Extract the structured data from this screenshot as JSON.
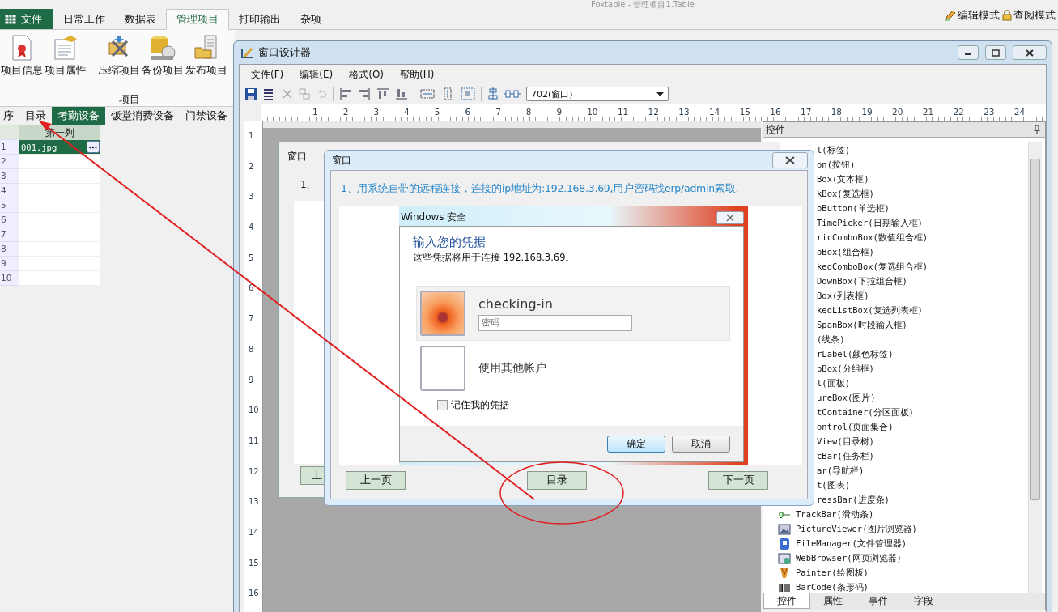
{
  "app_title": "Foxtable - 管理项目1.Table",
  "ribbon_tabs": [
    {
      "label": "文件",
      "kind": "file",
      "selected": false
    },
    {
      "label": "日常工作",
      "kind": "tab",
      "selected": false
    },
    {
      "label": "数据表",
      "kind": "tab",
      "selected": false
    },
    {
      "label": "管理项目",
      "kind": "tab",
      "selected": true
    },
    {
      "label": "打印输出",
      "kind": "tab",
      "selected": false
    },
    {
      "label": "杂项",
      "kind": "tab",
      "selected": false
    }
  ],
  "mode_buttons": [
    {
      "label": "编辑模式",
      "kind": "edit"
    },
    {
      "label": "查阅模式",
      "kind": "read"
    }
  ],
  "ribbon_buttons": [
    {
      "label": "项目信息",
      "kind": "info"
    },
    {
      "label": "项目属性",
      "kind": "props"
    },
    {
      "label": "压缩项目",
      "kind": "compress"
    },
    {
      "label": "备份项目",
      "kind": "backup"
    },
    {
      "label": "发布项目",
      "kind": "publish"
    }
  ],
  "ribbon_group": "项目",
  "sheet_tabs": [
    {
      "label": "序",
      "selected": false
    },
    {
      "label": "目录",
      "selected": false
    },
    {
      "label": "考勤设备",
      "selected": true
    },
    {
      "label": "饭堂消费设备",
      "selected": false
    },
    {
      "label": "门禁设备",
      "selected": false
    }
  ],
  "grid": {
    "column": "第一列",
    "rows": [
      {
        "number": "1",
        "value": "001.jpg",
        "selected": true
      },
      {
        "number": "2",
        "selected": false
      },
      {
        "number": "3",
        "selected": false
      },
      {
        "number": "4",
        "selected": false
      },
      {
        "number": "5",
        "selected": false
      },
      {
        "number": "6",
        "selected": false
      },
      {
        "number": "7",
        "selected": false
      },
      {
        "number": "8",
        "selected": false
      },
      {
        "number": "9",
        "selected": false
      },
      {
        "number": "10",
        "selected": false
      }
    ]
  },
  "designer": {
    "title": "窗口设计器",
    "menu": [
      "文件(F)",
      "编辑(E)",
      "格式(O)",
      "帮助(H)"
    ],
    "form_selector": "702(窗口)",
    "ruler_h": [
      "1",
      "2",
      "3",
      "4",
      "5",
      "6",
      "7",
      "8",
      "9",
      "10",
      "11",
      "12",
      "13",
      "14",
      "15",
      "16",
      "17",
      "18",
      "19",
      "20",
      "21",
      "22",
      "23",
      "24"
    ],
    "ruler_v": [
      "1",
      "2",
      "3",
      "4",
      "5",
      "6",
      "7",
      "8",
      "9",
      "10",
      "11",
      "12",
      "13",
      "14",
      "15",
      "16"
    ],
    "controls_panel": {
      "title": "控件",
      "items": [
        {
          "label": "l(标签)",
          "kind": "partial"
        },
        {
          "label": "on(按钮)",
          "kind": "partial"
        },
        {
          "label": "Box(文本框)",
          "kind": "partial"
        },
        {
          "label": "kBox(复选框)",
          "kind": "partial"
        },
        {
          "label": "oButton(单选框)",
          "kind": "partial"
        },
        {
          "label": "TimePicker(日期输入框)",
          "kind": "partial"
        },
        {
          "label": "ricComboBox(数值组合框)",
          "kind": "partial"
        },
        {
          "label": "oBox(组合框)",
          "kind": "partial"
        },
        {
          "label": "kedComboBox(复选组合框)",
          "kind": "partial"
        },
        {
          "label": "DownBox(下拉组合框)",
          "kind": "partial"
        },
        {
          "label": "Box(列表框)",
          "kind": "partial"
        },
        {
          "label": "kedListBox(复选列表框)",
          "kind": "partial"
        },
        {
          "label": "SpanBox(时段输入框)",
          "kind": "partial"
        },
        {
          "label": "(线条)",
          "kind": "partial"
        },
        {
          "label": "rLabel(颜色标签)",
          "kind": "partial"
        },
        {
          "label": "pBox(分组框)",
          "kind": "partial"
        },
        {
          "label": "l(面板)",
          "kind": "partial"
        },
        {
          "label": "ureBox(图片)",
          "kind": "partial"
        },
        {
          "label": "tContainer(分区面板)",
          "kind": "partial"
        },
        {
          "label": "ontrol(页面集合)",
          "kind": "partial"
        },
        {
          "label": "View(目录树)",
          "kind": "partial"
        },
        {
          "label": "cBar(任务栏)",
          "kind": "partial"
        },
        {
          "label": "ar(导航栏)",
          "kind": "partial"
        },
        {
          "label": "t(图表)",
          "kind": "partial"
        },
        {
          "label": "ressBar(进度条)",
          "kind": "partial"
        },
        {
          "label": "TrackBar(滑动条)",
          "kind": "trackbar"
        },
        {
          "label": "PictureViewer(图片浏览器)",
          "kind": "viewer"
        },
        {
          "label": "FileManager(文件管理器)",
          "kind": "files"
        },
        {
          "label": "WebBrowser(网页浏览器)",
          "kind": "web"
        },
        {
          "label": "Painter(绘图板)",
          "kind": "painter"
        },
        {
          "label": "BarCode(条形码)",
          "kind": "barcode"
        }
      ],
      "tabs": [
        {
          "label": "控件",
          "selected": true
        },
        {
          "label": "属性",
          "selected": false
        },
        {
          "label": "事件",
          "selected": false
        },
        {
          "label": "字段",
          "selected": false
        }
      ]
    }
  },
  "background_form": {
    "title": "窗口",
    "text": "1、",
    "button": "上"
  },
  "dialog": {
    "title": "窗口",
    "instruction": "1、用系统自带的远程连接，连接的ip地址为:192.168.3.69,用户密码找erp/admin索取.",
    "security": {
      "title": "Windows 安全",
      "heading": "输入您的凭据",
      "subtitle": "这些凭据将用于连接 192.168.3.69。",
      "user": "checking-in",
      "password_placeholder": "密码",
      "other_account": "使用其他帐户",
      "remember": {
        "label": "记住我的凭据",
        "checked": false
      },
      "ok": "确定",
      "cancel": "取消"
    },
    "buttons": [
      "上一页",
      "目录",
      "下一页"
    ]
  }
}
